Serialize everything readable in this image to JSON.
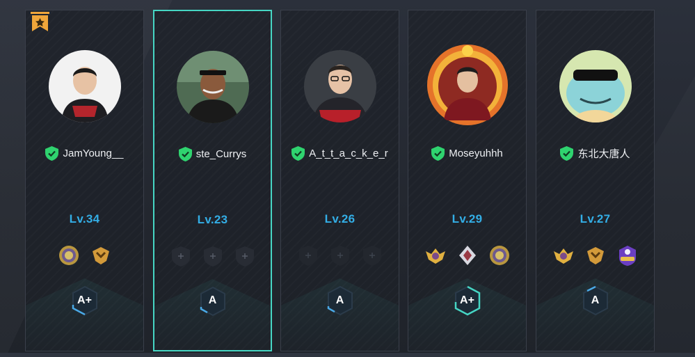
{
  "players": [
    {
      "name": "JamYoung__",
      "level": "Lv.34",
      "rank": "A+",
      "selected": false,
      "has_bookmark": true,
      "badges": [
        "gold-disc-badge",
        "wing-chevron-badge"
      ]
    },
    {
      "name": "ste_Currys",
      "level": "Lv.23",
      "rank": "A",
      "selected": true,
      "has_bookmark": false,
      "badges": [
        "empty-slot",
        "empty-slot",
        "empty-slot"
      ]
    },
    {
      "name": "A_t_t_a_c_k_e_r",
      "level": "Lv.26",
      "rank": "A",
      "selected": false,
      "has_bookmark": false,
      "badges": [
        "empty-slot",
        "empty-slot",
        "empty-slot"
      ]
    },
    {
      "name": "Moseyuhhh",
      "level": "Lv.29",
      "rank": "A+",
      "selected": false,
      "has_bookmark": false,
      "badges": [
        "gold-wing-badge",
        "silver-diamond-badge",
        "gold-disc-badge"
      ]
    },
    {
      "name": "东北大唐人",
      "level": "Lv.27",
      "rank": "A",
      "selected": false,
      "has_bookmark": false,
      "badges": [
        "gold-wing-badge",
        "wing-chevron-badge",
        "purple-crest-badge"
      ]
    }
  ],
  "colors": {
    "level": "#33aee6",
    "selected_border": "#46d6c4",
    "verified_shield": "#2fd36f",
    "bookmark": "#f0a63a"
  },
  "icons": {
    "verified": "green-shield-check-icon",
    "bookmark": "star-bookmark-icon",
    "empty_slot": "plus-icon"
  }
}
